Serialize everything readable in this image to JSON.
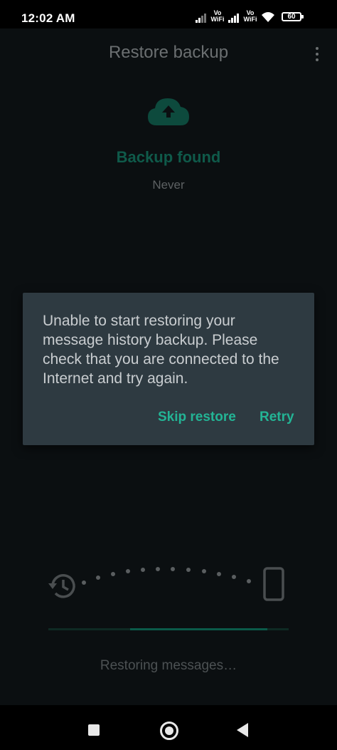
{
  "status_bar": {
    "time": "12:02 AM",
    "vo_label_1": "Vo\nWiFi",
    "vo_label_2": "Vo\nWiFi",
    "battery": "60"
  },
  "app": {
    "title": "Restore backup",
    "backup_status": "Backup found",
    "backup_date": "Never",
    "restoring_text": "Restoring messages…",
    "accent_color": "#23b495"
  },
  "dialog": {
    "message": "Unable to start restoring your message history backup. Please check that you are connected to the Internet and try again.",
    "skip_label": "Skip restore",
    "retry_label": "Retry"
  },
  "progress": {
    "fraction_start": 0.34,
    "fraction_end": 0.91
  }
}
